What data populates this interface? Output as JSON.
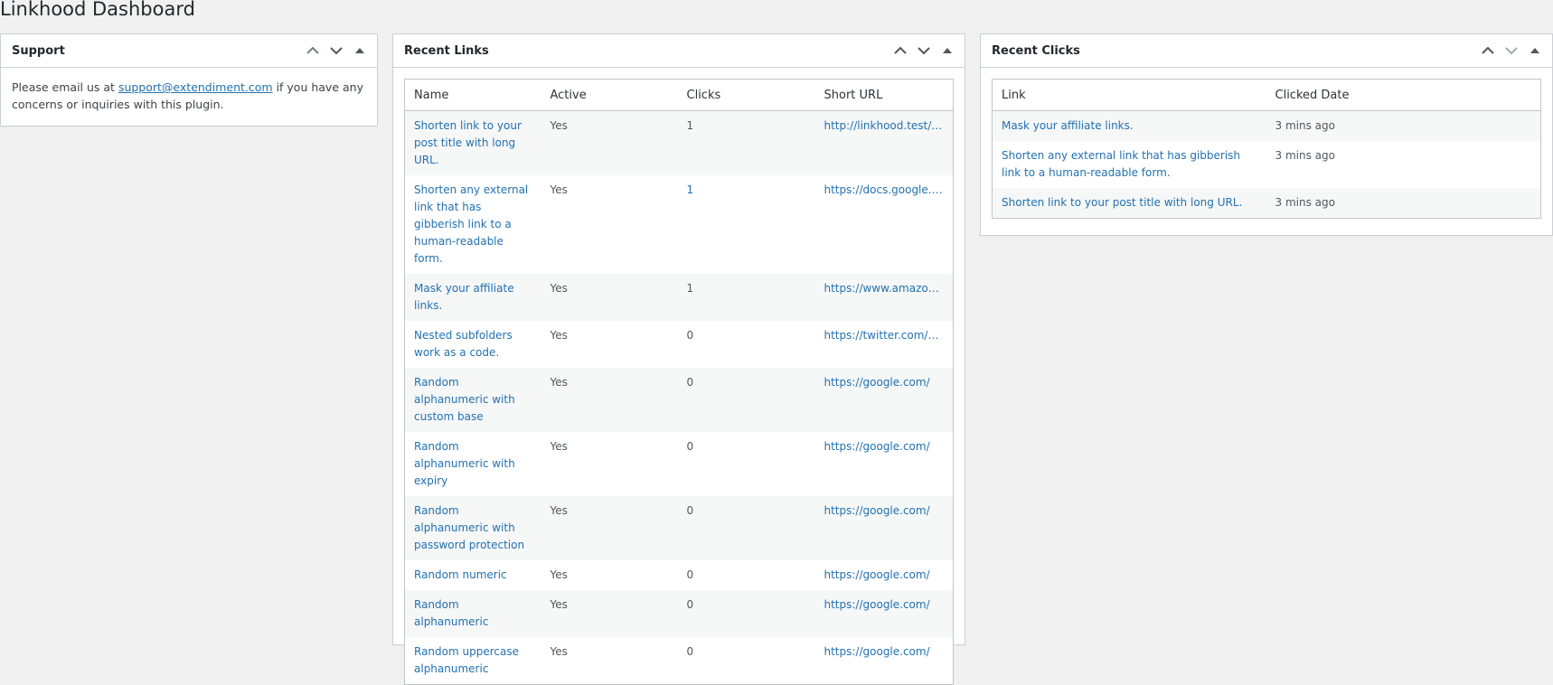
{
  "page": {
    "title": "Linkhood Dashboard"
  },
  "support": {
    "title": "Support",
    "text_before": "Please email us at ",
    "email": "support@extendiment.com",
    "text_after": " if you have any concerns or inquiries with this plugin."
  },
  "recent_links": {
    "title": "Recent Links",
    "columns": {
      "name": "Name",
      "active": "Active",
      "clicks": "Clicks",
      "short_url": "Short URL"
    },
    "rows": [
      {
        "name": "Shorten link to your post title with long URL.",
        "active": "Yes",
        "clicks": "1",
        "short_url": "http://linkhood.test/t…"
      },
      {
        "name": "Shorten any external link that has gibberish link to a human-readable form.",
        "active": "Yes",
        "clicks": "1",
        "short_url": "https://docs.google.c…"
      },
      {
        "name": "Mask your affiliate links.",
        "active": "Yes",
        "clicks": "1",
        "short_url": "https://www.amazon.…"
      },
      {
        "name": "Nested subfolders work as a code.",
        "active": "Yes",
        "clicks": "0",
        "short_url": "https://twitter.com/E…"
      },
      {
        "name": "Random alphanumeric with custom base",
        "active": "Yes",
        "clicks": "0",
        "short_url": "https://google.com/"
      },
      {
        "name": "Random alphanumeric with expiry",
        "active": "Yes",
        "clicks": "0",
        "short_url": "https://google.com/"
      },
      {
        "name": "Random alphanumeric with password protection",
        "active": "Yes",
        "clicks": "0",
        "short_url": "https://google.com/"
      },
      {
        "name": "Random numeric",
        "active": "Yes",
        "clicks": "0",
        "short_url": "https://google.com/"
      },
      {
        "name": "Random alphanumeric",
        "active": "Yes",
        "clicks": "0",
        "short_url": "https://google.com/"
      },
      {
        "name": "Random uppercase alphanumeric",
        "active": "Yes",
        "clicks": "0",
        "short_url": "https://google.com/"
      }
    ]
  },
  "recent_clicks": {
    "title": "Recent Clicks",
    "columns": {
      "link": "Link",
      "clicked_date": "Clicked Date"
    },
    "rows": [
      {
        "link": "Mask your affiliate links.",
        "clicked_date": "3 mins ago"
      },
      {
        "link": "Shorten any external link that has gibberish link to a human-readable form.",
        "clicked_date": "3 mins ago"
      },
      {
        "link": "Shorten link to your post title with long URL.",
        "clicked_date": "3 mins ago"
      }
    ]
  },
  "icons": {
    "move_up": "chevron-up-icon",
    "move_down": "chevron-down-icon",
    "toggle": "triangle-up-icon"
  },
  "colors": {
    "link": "#2271b1",
    "background": "#f1f1f1",
    "border": "#ccd0d4"
  }
}
